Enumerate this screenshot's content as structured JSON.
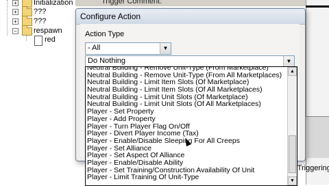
{
  "tree": {
    "items": [
      {
        "label": "Initialization",
        "icon": "folder-icon",
        "expander": "+"
      },
      {
        "label": "???",
        "icon": "folder-icon",
        "expander": "+"
      },
      {
        "label": "???",
        "icon": "folder-icon",
        "expander": "+"
      },
      {
        "label": "respawn",
        "icon": "folder-open-icon",
        "expander": "−"
      },
      {
        "label": "red",
        "icon": "trigger-doc-icon",
        "expander": ""
      }
    ]
  },
  "background": {
    "trigger_comment_label": "Trigger Comment:",
    "triggering_text": "(Triggering"
  },
  "dialog": {
    "title": "Configure Action",
    "action_type_label": "Action Type",
    "action_type_value": "- All",
    "action_value": "Do Nothing",
    "dropdown_items": [
      "Neutral Building - Remove Unit-Type (From Marketplace)",
      "Neutral Building - Remove Unit-Type (From All Marketplaces)",
      "Neutral Building - Limit Item Slots (Of Marketplace)",
      "Neutral Building - Limit Item Slots (Of All Marketplaces)",
      "Neutral Building - Limit Unit Slots (Of Marketplace)",
      "Neutral Building - Limit Unit Slots (Of All Marketplaces)",
      "Player - Set Property",
      "Player - Add Property",
      "Player - Turn Player Flag On/Off",
      "Player - Divert Player Income (Tax)",
      "Player - Enable/Disable Sleeping For All Creeps",
      "Player - Set Alliance",
      "Player - Set Aspect Of Alliance",
      "Player - Enable/Disable Ability",
      "Player - Set Training/Construction Availability Of Unit",
      "Player - Limit Training Of Unit-Type"
    ]
  },
  "colors": {
    "dialog_border": "#6d7f99",
    "folder": "#f2d47a"
  }
}
